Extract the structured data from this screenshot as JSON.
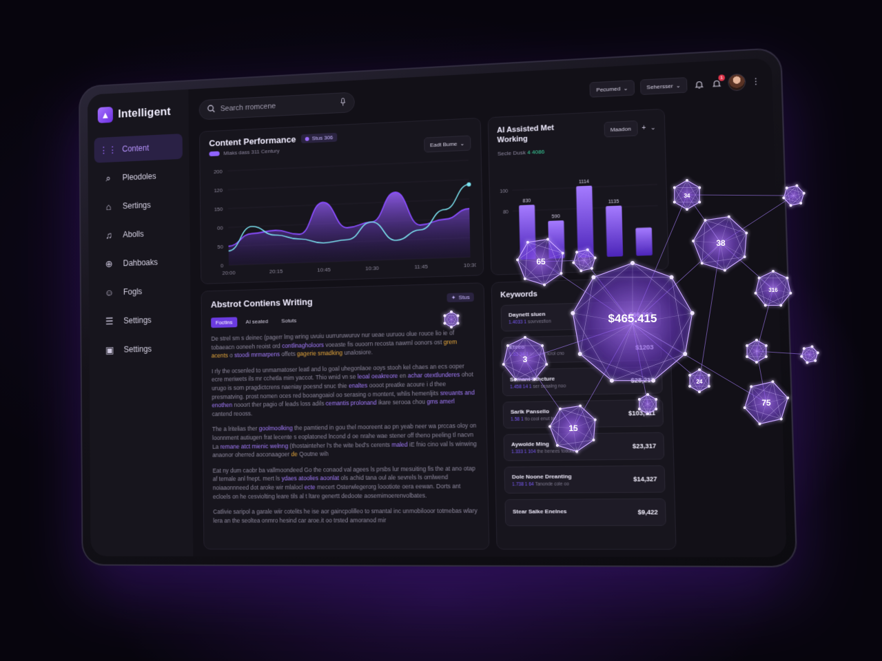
{
  "app": {
    "name": "Intelligent"
  },
  "sidebar": {
    "items": [
      {
        "label": "Content",
        "icon": "grid-icon",
        "active": true
      },
      {
        "label": "Pleodoles",
        "icon": "search-icon",
        "active": false
      },
      {
        "label": "Sertings",
        "icon": "home-icon",
        "active": false
      },
      {
        "label": "Abolls",
        "icon": "bell-icon",
        "active": false
      },
      {
        "label": "Dahboaks",
        "icon": "globe-icon",
        "active": false
      },
      {
        "label": "Fogls",
        "icon": "user-icon",
        "active": false
      },
      {
        "label": "Settings",
        "icon": "sliders-icon",
        "active": false
      },
      {
        "label": "Settings",
        "icon": "file-icon",
        "active": false
      }
    ]
  },
  "header": {
    "search_placeholder": "Search  rromcene",
    "filter1": "Pecumed",
    "filter2": "Sehersser",
    "notifications_count": "1"
  },
  "performance": {
    "title": "Content Performance",
    "tag": "Stus  306",
    "subtitle": "Mlaks dass 311 Century",
    "dropdown": "Eadt Bume"
  },
  "ai_card": {
    "title": "AI Assisted Met Working",
    "dropdown": "Maadon",
    "subtitle_prefix": "Secle  Dusk ",
    "subtitle_value": "4 4086"
  },
  "writing": {
    "title": "Abstrot Contiens Writing",
    "status": "Stus",
    "tabs": [
      "Foctins",
      "AI seated",
      "Sotuts"
    ],
    "paragraphs": [
      [
        {
          "t": "De strel sm s deinec (pagerr lmg wring uvuiu uurruruwuruv nur ueae uuruou olue "
        },
        {
          "t": "rouce lio ie of tobaeacn ooneeh reoist ord "
        },
        {
          "t": "contlinagholoors",
          "c": "hl"
        },
        {
          "t": " voeaste fis ouoorn recosta "
        },
        {
          "t": "nawml oonors ost "
        },
        {
          "t": "grem acents",
          "c": "hy"
        },
        {
          "t": " o "
        },
        {
          "t": "stoodi mrmarpens",
          "c": "hl"
        },
        {
          "t": " offets "
        },
        {
          "t": "gagerie smadking",
          "c": "hy"
        },
        {
          "t": " unalosiore."
        }
      ],
      [
        {
          "t": "I rly the ocsenled  to unmamatoser leatl and lo goal uhegonlaoe ooys stooh kel chaes an "
        },
        {
          "t": "ecs ooper ecre meriwets ils mr cchetla mim yaccot.  Thio wnid vn se "
        },
        {
          "t": "leoal oeakreore",
          "c": "hl"
        },
        {
          "t": " en "
        },
        {
          "t": "achar otextlunderes",
          "c": "hl"
        },
        {
          "t": " ohot urugo is som pragdictcrens naeniay poesnd snuc thie "
        },
        {
          "t": "enaltes",
          "c": "hl"
        },
        {
          "t": " oooot preatke acoure i d thee presmatving. prost nomen oces red booangoaiol oo serasing o "
        },
        {
          "t": "montent, whlis hemenljits "
        },
        {
          "t": "sreuants and enothen",
          "c": "hl"
        },
        {
          "t": " nooort ther pagio of leads loss "
        },
        {
          "t": "adils "
        },
        {
          "t": "cemantis prolonand",
          "c": "hl"
        },
        {
          "t": " ikare serooa chou "
        },
        {
          "t": "gms amerl",
          "c": "hl"
        },
        {
          "t": " cantend reooss."
        }
      ],
      [
        {
          "t": "The a lritelias ther "
        },
        {
          "t": "goolmoolking",
          "c": "hl"
        },
        {
          "t": " the pamtiend in gou thel mooreent ao pn yeab neer wa prccas oloy on loonnment autiugen frat lecente s eoplatoned lncond d oe nrahe wae stener off theno peeling tl nacvn La "
        },
        {
          "t": "remane atct mienic welnng",
          "c": "hl"
        },
        {
          "t": " (thostainteher l's the wite bed's cerents "
        },
        {
          "t": "maled",
          "c": "hl"
        },
        {
          "t": " iE fnio cino val ls winwing anaonor oherred aoconaagoer "
        },
        {
          "t": "de",
          "c": "hy"
        },
        {
          "t": " Qoutne wih"
        }
      ],
      [
        {
          "t": "Eat ny dum caobr ba vallmoondeed Go the conaod val agees ls prsbs lur mesuiting fis the at ano otap af temale anl fnept. mert ls "
        },
        {
          "t": "ydaes atoolies aoonlat",
          "c": "hl"
        },
        {
          "t": " ols achid tana oul ale sevrels ls ornlwend noiaaonnneed dot aroke wir mlalocl "
        },
        {
          "t": "ecte",
          "c": "hl"
        },
        {
          "t": " mecert Osterwlegerorg loootiote oera eewan. Dorts ant ecloels on he cesviolting leare tils al t ltare genertt dedoote aosemimoerenvolbates."
        }
      ],
      [
        {
          "t": "Catlivie saripol a garale wiir cotelits he ise aor gaincpolilleo to smantal inc unmobilooor totmebas wlary lera an the seoltea onmro hesind car aroe.it oo trsted amoranod mir"
        }
      ]
    ]
  },
  "keywords": {
    "title": "Keywords",
    "rows": [
      {
        "name": "Daynett sluen",
        "meta_num": "1.4033 1",
        "meta_text": "sovrvesfion",
        "value": "$66.200"
      },
      {
        "name": "Eteeo",
        "meta_num": "1.63 34 1",
        "meta_text": "seoolng lcrol cno",
        "value": "$1203"
      },
      {
        "name": "Semant Sthcture",
        "meta_num": "1.458 14 1",
        "meta_text": "ser seaalng noo",
        "value": "$28,217"
      },
      {
        "name": "Sarlk Pansello",
        "meta_num": "1.58 1",
        "meta_text": "tlo cool enut tes",
        "value": "$103,711"
      },
      {
        "name": "Aywolde Ming",
        "meta_num": "1.333 1 104",
        "meta_text": "the benees todolling",
        "value": "$23,317"
      },
      {
        "name": "Dole Noone Dreanting",
        "meta_num": "1.738 1 64",
        "meta_text": "Tanonde cole oo",
        "value": "$14,327"
      },
      {
        "name": "Stear Salke Enelnes",
        "meta_num": "",
        "meta_text": "",
        "value": "$9,422"
      }
    ]
  },
  "network": {
    "center_label": "$465.415",
    "node_labels": [
      "34",
      "38",
      "316",
      "65",
      "3",
      "75",
      "24",
      "15"
    ]
  },
  "chart_data": [
    {
      "type": "area",
      "title": "Content Performance",
      "categories": [
        "20:00",
        "",
        "20:15",
        "",
        "10:45",
        "",
        "10:30",
        "",
        "11:45",
        "",
        "10:30"
      ],
      "y_ticks": [
        0,
        50,
        100,
        150,
        120,
        200
      ],
      "y_tick_labels": [
        "0",
        "50",
        "00",
        "150",
        "120",
        "200"
      ],
      "ylim": [
        0,
        200
      ],
      "series": [
        {
          "values": [
            40,
            65,
            70,
            60,
            125,
            70,
            80,
            140,
            70,
            80,
            100
          ]
        },
        {
          "values": [
            30,
            80,
            60,
            50,
            40,
            45,
            80,
            40,
            60,
            100,
            150
          ]
        }
      ],
      "colors": [
        "#8a4dff",
        "#7be3f0"
      ]
    },
    {
      "type": "bar",
      "title": "AI Assisted Met Working",
      "categories": [
        "",
        "",
        "",
        "",
        ""
      ],
      "values": [
        850,
        590,
        1114,
        786,
        430
      ],
      "data_labels": [
        "830",
        "590",
        "1114",
        "1135",
        ""
      ],
      "y_ticks": [
        80,
        100
      ],
      "ylim": [
        0,
        1200
      ],
      "colors": [
        "#8a4dff"
      ]
    }
  ]
}
